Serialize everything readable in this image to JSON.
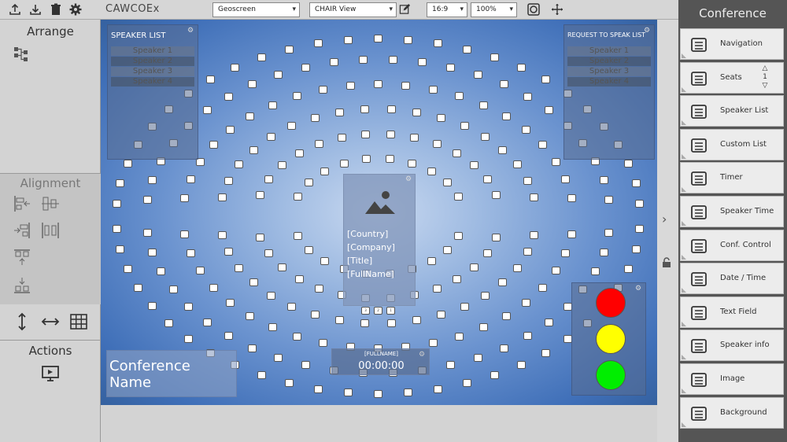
{
  "app": {
    "title": "CAWCOEx"
  },
  "toolbar": {
    "geoscreen_select": "Geoscreen",
    "view_select": "CHAIR View",
    "aspect_select": "16:9",
    "zoom_select": "100%"
  },
  "left_panel": {
    "arrange_title": "Arrange",
    "alignment_title": "Alignment",
    "actions_title": "Actions"
  },
  "speaker_list": {
    "title": "SPEAKER LIST",
    "items": [
      "Speaker 1",
      "Speaker 2",
      "Speaker 3",
      "Speaker 4"
    ]
  },
  "request_list": {
    "title": "REQUEST TO SPEAK LIST",
    "items": [
      "Speaker 1",
      "Speaker 2",
      "Speaker 3",
      "Speaker 4"
    ]
  },
  "speaker_card": {
    "country": "[Country]",
    "company": "[Company]",
    "title": "[Title]",
    "fullname": "[FullName]"
  },
  "timer": {
    "label": "[FULLNAME]",
    "time": "00:00:00"
  },
  "conference_name": "Conference Name",
  "traffic_light": {
    "colors": [
      "#ff0000",
      "#ffff00",
      "#00ee00"
    ]
  },
  "right_panel": {
    "title": "Conference",
    "items": [
      {
        "label": "Navigation",
        "icon": "navigation-icon"
      },
      {
        "label": "Seats",
        "icon": "seats-icon"
      },
      {
        "label": "Speaker List",
        "icon": "speaker-list-icon"
      },
      {
        "label": "Custom List",
        "icon": "custom-list-icon"
      },
      {
        "label": "Timer",
        "icon": "timer-icon"
      },
      {
        "label": "Speaker Time",
        "icon": "traffic-light-icon"
      },
      {
        "label": "Conf. Control",
        "icon": "info-icon"
      },
      {
        "label": "Date / Time",
        "icon": "calendar-icon"
      },
      {
        "label": "Text Field",
        "icon": "text-field-icon"
      },
      {
        "label": "Speaker info",
        "icon": "user-icon"
      },
      {
        "label": "Image",
        "icon": "image-icon"
      },
      {
        "label": "Background",
        "icon": "background-icon"
      }
    ],
    "seats_count": "1"
  },
  "center_seats": [
    "3",
    "2",
    "1"
  ]
}
